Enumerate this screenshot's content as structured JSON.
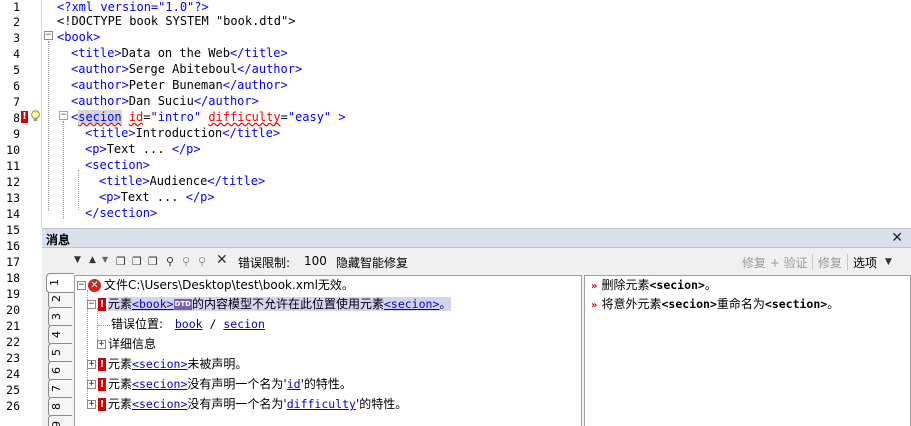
{
  "editor": {
    "lines": [
      {
        "n": "1"
      },
      {
        "n": "2"
      },
      {
        "n": "3"
      },
      {
        "n": "4"
      },
      {
        "n": "5"
      },
      {
        "n": "6"
      },
      {
        "n": "7"
      },
      {
        "n": "8"
      },
      {
        "n": "9"
      },
      {
        "n": "10"
      },
      {
        "n": "11"
      },
      {
        "n": "12"
      },
      {
        "n": "13"
      },
      {
        "n": "14"
      },
      {
        "n": "15"
      },
      {
        "n": "16"
      },
      {
        "n": "17"
      },
      {
        "n": "18"
      },
      {
        "n": "19"
      },
      {
        "n": "20"
      },
      {
        "n": "21"
      },
      {
        "n": "22"
      },
      {
        "n": "23"
      },
      {
        "n": "24"
      },
      {
        "n": "25"
      },
      {
        "n": "26"
      }
    ],
    "code": {
      "l1": "<?xml version=\"1.0\"?>",
      "l2": "<!DOCTYPE book SYSTEM \"book.dtd\">",
      "l3_tag": "<book>",
      "l4_open": "<title>",
      "l4_text": "Data on the Web",
      "l4_close": "</title>",
      "l5_open": "<author>",
      "l5_text": "Serge Abiteboul",
      "l5_close": "</author>",
      "l6_open": "<author>",
      "l6_text": "Peter Buneman",
      "l6_close": "</author>",
      "l7_open": "<author>",
      "l7_text": "Dan Suciu",
      "l7_close": "</author>",
      "l8_lt": "<",
      "l8_name": "secion",
      "l8_attr1": "id",
      "l8_eq1": "=",
      "l8_val1": "\"intro\"",
      "l8_attr2": "difficulty",
      "l8_eq2": "=",
      "l8_val2": "\"easy\"",
      "l8_gt": " >",
      "l9_open": "<title>",
      "l9_text": "Introduction",
      "l9_close": "</title>",
      "l10_open": "<p>",
      "l10_text": "Text ... ",
      "l10_close": "</p>",
      "l11_tag": "<section>",
      "l12_open": "<title>",
      "l12_text": "Audience",
      "l12_close": "</title>",
      "l13_open": "<p>",
      "l13_text": "Text ... ",
      "l13_close": "</p>",
      "l14_tag": "</section>"
    }
  },
  "panel": {
    "title": "消息",
    "close": "✕",
    "toolbar": {
      "error_limit_label": "错误限制:",
      "error_limit_value": "100",
      "hide_smart_fix": "隐藏智能修复",
      "fix_validate": "修复 + 验证",
      "fix": "修复",
      "options": "选项"
    },
    "tabs": [
      "1",
      "2",
      "3",
      "4",
      "5",
      "6",
      "7",
      "8",
      "9"
    ],
    "messages": {
      "root": "文件C:\\Users\\Desktop\\test\\book.xml无效。",
      "m1_a": "元素",
      "m1_el1": "<book>",
      "m1_b": "的内容模型不允许在此位置使用元素",
      "m1_el2": "<secion>",
      "m1_c": "。",
      "loc_label": "错误位置:",
      "loc_path_1": "book",
      "loc_sep": " / ",
      "loc_path_2": "secion",
      "details": "详细信息",
      "m2_a": "元素",
      "m2_el": "<secion>",
      "m2_b": "未被声明。",
      "m3_a": "元素",
      "m3_el": "<secion>",
      "m3_b": "没有声明一个名为'",
      "m3_attr": "id",
      "m3_c": "'的特性。",
      "m4_a": "元素",
      "m4_el": "<secion>",
      "m4_b": "没有声明一个名为'",
      "m4_attr": "difficulty",
      "m4_c": "'的特性。"
    },
    "fixes": {
      "f1_a": "删除元素",
      "f1_el": "<secion>",
      "f1_b": "。",
      "f2_a": "将意外元素",
      "f2_el1": "<secion>",
      "f2_b": "重命名为",
      "f2_el2": "<section>",
      "f2_c": "。"
    }
  },
  "colors": {
    "tag": "#0000ff",
    "attribute": "#ff0000",
    "error": "#d20000",
    "panel_title_bg": "#d8e0ec"
  }
}
